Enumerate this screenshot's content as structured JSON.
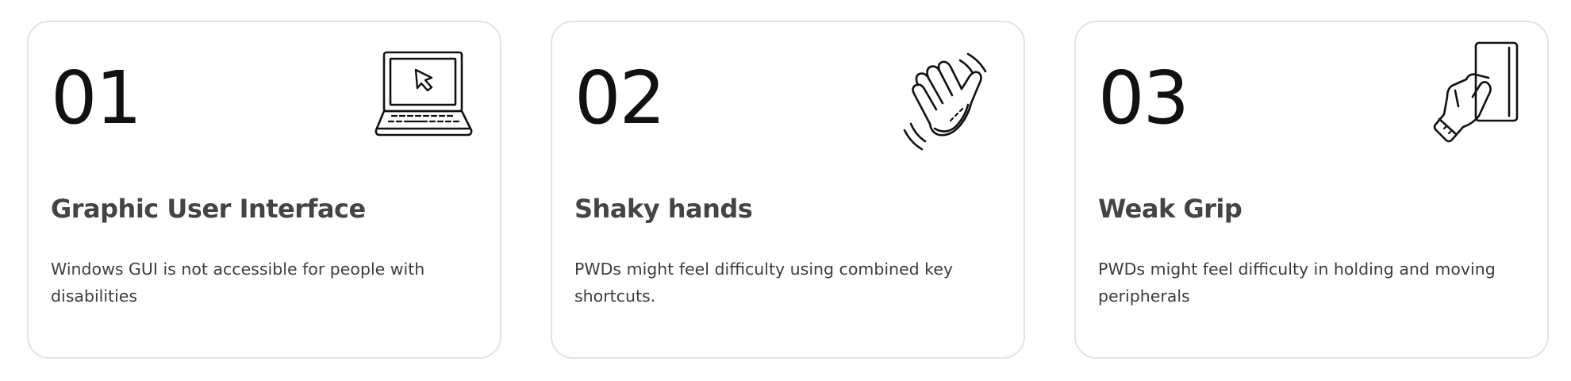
{
  "cards": [
    {
      "number": "01",
      "title": "Graphic User Interface",
      "description": "Windows GUI is not accessible for people with disabilities",
      "icon": "laptop-cursor-icon"
    },
    {
      "number": "02",
      "title": "Shaky hands",
      "description": "PWDs might feel difficulty using combined key shortcuts.",
      "icon": "waving-hand-icon"
    },
    {
      "number": "03",
      "title": "Weak Grip",
      "description": "PWDs might feel difficulty in holding and moving peripherals",
      "icon": "hand-holding-device-icon"
    }
  ],
  "colors": {
    "number_text": "#111111",
    "title_text": "#444444",
    "body_text": "#3d3d3d",
    "card_border": "#e3e3e3",
    "icon_stroke": "#111111"
  }
}
